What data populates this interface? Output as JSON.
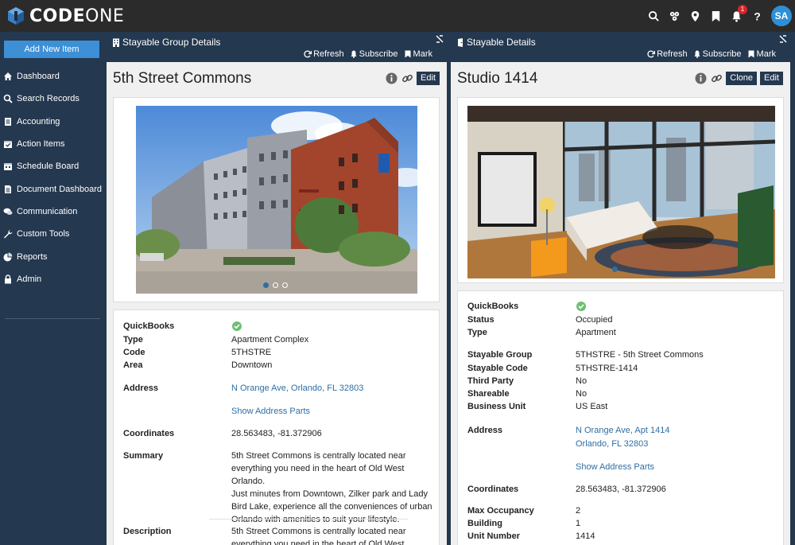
{
  "app": {
    "brand_bold": "CODE",
    "brand_light": "ONE",
    "notification_count": "1",
    "avatar_initials": "SA"
  },
  "topbar_icons": [
    "search-icon",
    "org-icon",
    "location-icon",
    "bookmark-icon",
    "bell-icon",
    "help-icon"
  ],
  "sidebar": {
    "add_button": "Add New Item",
    "items": [
      {
        "label": "Dashboard",
        "icon": "home-icon"
      },
      {
        "label": "Search Records",
        "icon": "search-icon"
      },
      {
        "label": "Accounting",
        "icon": "ledger-icon"
      },
      {
        "label": "Action Items",
        "icon": "calendar-check-icon"
      },
      {
        "label": "Schedule Board",
        "icon": "calendar-icon"
      },
      {
        "label": "Document Dashboard",
        "icon": "document-icon"
      },
      {
        "label": "Communication",
        "icon": "chat-icon"
      },
      {
        "label": "Custom Tools",
        "icon": "wrench-icon"
      },
      {
        "label": "Reports",
        "icon": "pie-chart-icon"
      },
      {
        "label": "Admin",
        "icon": "lock-icon"
      }
    ]
  },
  "left_panel": {
    "header_title": "Stayable Group Details",
    "actions": {
      "refresh": "Refresh",
      "subscribe": "Subscribe",
      "mark": "Mark"
    },
    "record_title": "5th Street Commons",
    "edit_label": "Edit",
    "fields": {
      "quickbooks_label": "QuickBooks",
      "type_label": "Type",
      "type_value": "Apartment Complex",
      "code_label": "Code",
      "code_value": "5THSTRE",
      "area_label": "Area",
      "area_value": "Downtown",
      "address_label": "Address",
      "address_value": "N Orange Ave, Orlando, FL 32803",
      "show_address_parts": "Show Address Parts",
      "coordinates_label": "Coordinates",
      "coordinates_value": "28.563483, -81.372906",
      "summary_label": "Summary",
      "summary_lines": [
        "5th Street Commons is centrally located near",
        "everything you need in the heart of Old West Orlando.",
        "Just minutes from Downtown, Zilker park and Lady",
        "Bird Lake, experience all the conveniences of urban",
        "Orlando with amenities to suit your lifestyle."
      ],
      "description_label": "Description",
      "description_lines": [
        "5th Street Commons is centrally located near",
        "everything you need in the heart of Old West Orlando."
      ]
    }
  },
  "right_panel": {
    "header_title": "Stayable Details",
    "actions": {
      "refresh": "Refresh",
      "subscribe": "Subscribe",
      "mark": "Mark"
    },
    "record_title": "Studio 1414",
    "clone_label": "Clone",
    "edit_label": "Edit",
    "fields": {
      "quickbooks_label": "QuickBooks",
      "status_label": "Status",
      "status_value": "Occupied",
      "type_label": "Type",
      "type_value": "Apartment",
      "group_label": "Stayable Group",
      "group_value": "5THSTRE - 5th Street Commons",
      "code_label": "Stayable Code",
      "code_value": "5THSTRE-1414",
      "third_party_label": "Third Party",
      "third_party_value": "No",
      "shareable_label": "Shareable",
      "shareable_value": "No",
      "business_unit_label": "Business Unit",
      "business_unit_value": "US East",
      "address_label": "Address",
      "address_line1": "N Orange Ave, Apt 1414",
      "address_line2": "Orlando, FL 32803",
      "show_address_parts": "Show Address Parts",
      "coordinates_label": "Coordinates",
      "coordinates_value": "28.563483, -81.372906",
      "max_occupancy_label": "Max Occupancy",
      "max_occupancy_value": "2",
      "building_label": "Building",
      "building_value": "1",
      "unit_number_label": "Unit Number",
      "unit_number_value": "1414"
    }
  },
  "colors": {
    "navy": "#24384f",
    "topbar": "#2b2b2b",
    "accent": "#3d8fd6",
    "link": "#2f6ea3",
    "check": "#6cc070"
  }
}
